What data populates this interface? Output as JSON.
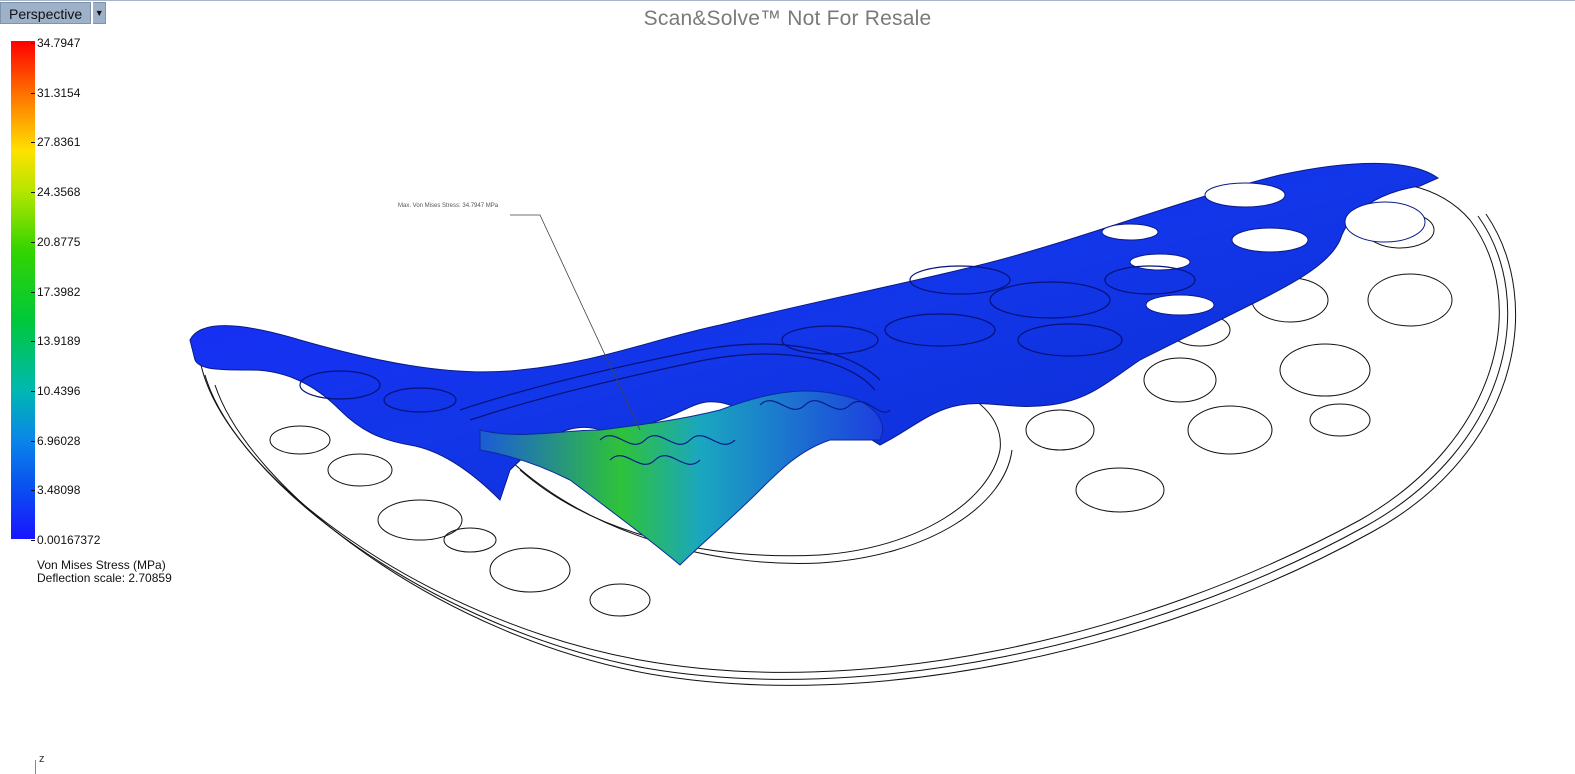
{
  "viewport": {
    "view_name": "Perspective",
    "watermark": "Scan&Solve™ Not For Resale"
  },
  "legend": {
    "ticks": [
      "34.7947",
      "31.3154",
      "27.8361",
      "24.3568",
      "20.8775",
      "17.3982",
      "13.9189",
      "10.4396",
      "6.96028",
      "3.48098",
      "0.00167372"
    ],
    "title": "Von Mises Stress (MPa)",
    "deflection": "Deflection scale: 2.70859",
    "colors": {
      "max": "#ff0000",
      "mid": "#33d400",
      "min": "#1a14ff"
    }
  },
  "annotation": {
    "max_label": "Max. Von Mises Stress: 34.7947 MPa"
  },
  "axis": {
    "z_label": "z"
  },
  "icons": {
    "view_menu": "chevron-down-icon"
  }
}
